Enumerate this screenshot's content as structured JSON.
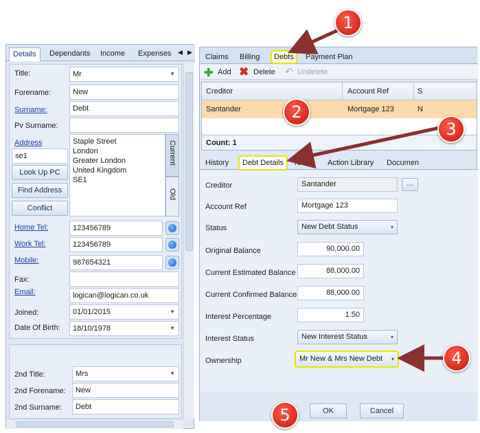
{
  "left": {
    "tabs": [
      "Details",
      "Dependants",
      "Income",
      "Expenses"
    ],
    "title": {
      "label": "Title:",
      "value": "Mr"
    },
    "forename": {
      "label": "Forename:",
      "value": "New"
    },
    "surname": {
      "label": "Surname:",
      "value": "Debt"
    },
    "pv_surname": {
      "label": "Pv Surname:",
      "value": ""
    },
    "address": {
      "label": "Address",
      "postcode": "se1",
      "lines": [
        "Staple Street",
        "London",
        "Greater London",
        "United Kingdom",
        "SE1"
      ],
      "current_tab": "Current",
      "old_tab": "Old"
    },
    "buttons": {
      "lookup": "Look Up PC",
      "find": "Find Address",
      "conflict": "Conflict"
    },
    "home_tel": {
      "label": "Home Tel:",
      "value": "123456789"
    },
    "work_tel": {
      "label": "Work Tel:",
      "value": "123456789"
    },
    "mobile": {
      "label": "Mobile:",
      "value": "987654321"
    },
    "fax": {
      "label": "Fax:",
      "value": ""
    },
    "email": {
      "label": "Email:",
      "value": "logican@logican.co.uk"
    },
    "joined": {
      "label": "Joined:",
      "value": "01/01/2015"
    },
    "dob": {
      "label": "Date Of Birth:",
      "value": "18/10/1978"
    },
    "title2": {
      "label": "2nd Title:",
      "value": "Mrs"
    },
    "forename2": {
      "label": "2nd Forename:",
      "value": "New"
    },
    "surname2": {
      "label": "2nd Surname:",
      "value": "Debt"
    }
  },
  "right": {
    "tabs": [
      "Claims",
      "Billing",
      "Debts",
      "Payment Plan"
    ],
    "toolbar": {
      "add": "Add",
      "delete": "Delete",
      "undelete": "Undelete"
    },
    "grid": {
      "headers": [
        "Creditor",
        "Account Ref",
        "S"
      ],
      "row": [
        "Santander",
        "Mortgage 123",
        "N"
      ],
      "count": "Count: 1"
    },
    "subtabs": [
      "History",
      "Debt Details",
      "To Do",
      "Action Library",
      "Documen"
    ],
    "form": {
      "creditor": {
        "label": "Creditor",
        "value": "Santander",
        "browse": "..."
      },
      "account_ref": {
        "label": "Account Ref",
        "value": "Mortgage 123"
      },
      "status": {
        "label": "Status",
        "value": "New Debt Status"
      },
      "original_balance": {
        "label": "Original Balance",
        "value": "90,000.00"
      },
      "current_estimated": {
        "label": "Current Estimated Balance",
        "value": "88,000.00"
      },
      "current_confirmed": {
        "label": "Current Confirmed Balance",
        "value": "88,000.00"
      },
      "interest_pct": {
        "label": "Interest Percentage",
        "value": "1.50"
      },
      "interest_status": {
        "label": "Interest Status",
        "value": "New Interest Status"
      },
      "ownership": {
        "label": "Ownership",
        "value": "Mr New & Mrs New Debt"
      }
    },
    "ok": "OK",
    "cancel": "Cancel"
  },
  "callouts": [
    "1",
    "2",
    "3",
    "4",
    "5"
  ],
  "colors": {
    "callout": "#d9241a",
    "arrow": "#8b2f2f",
    "highlight": "#e6e600",
    "selected_row": "#fbd9a8"
  }
}
